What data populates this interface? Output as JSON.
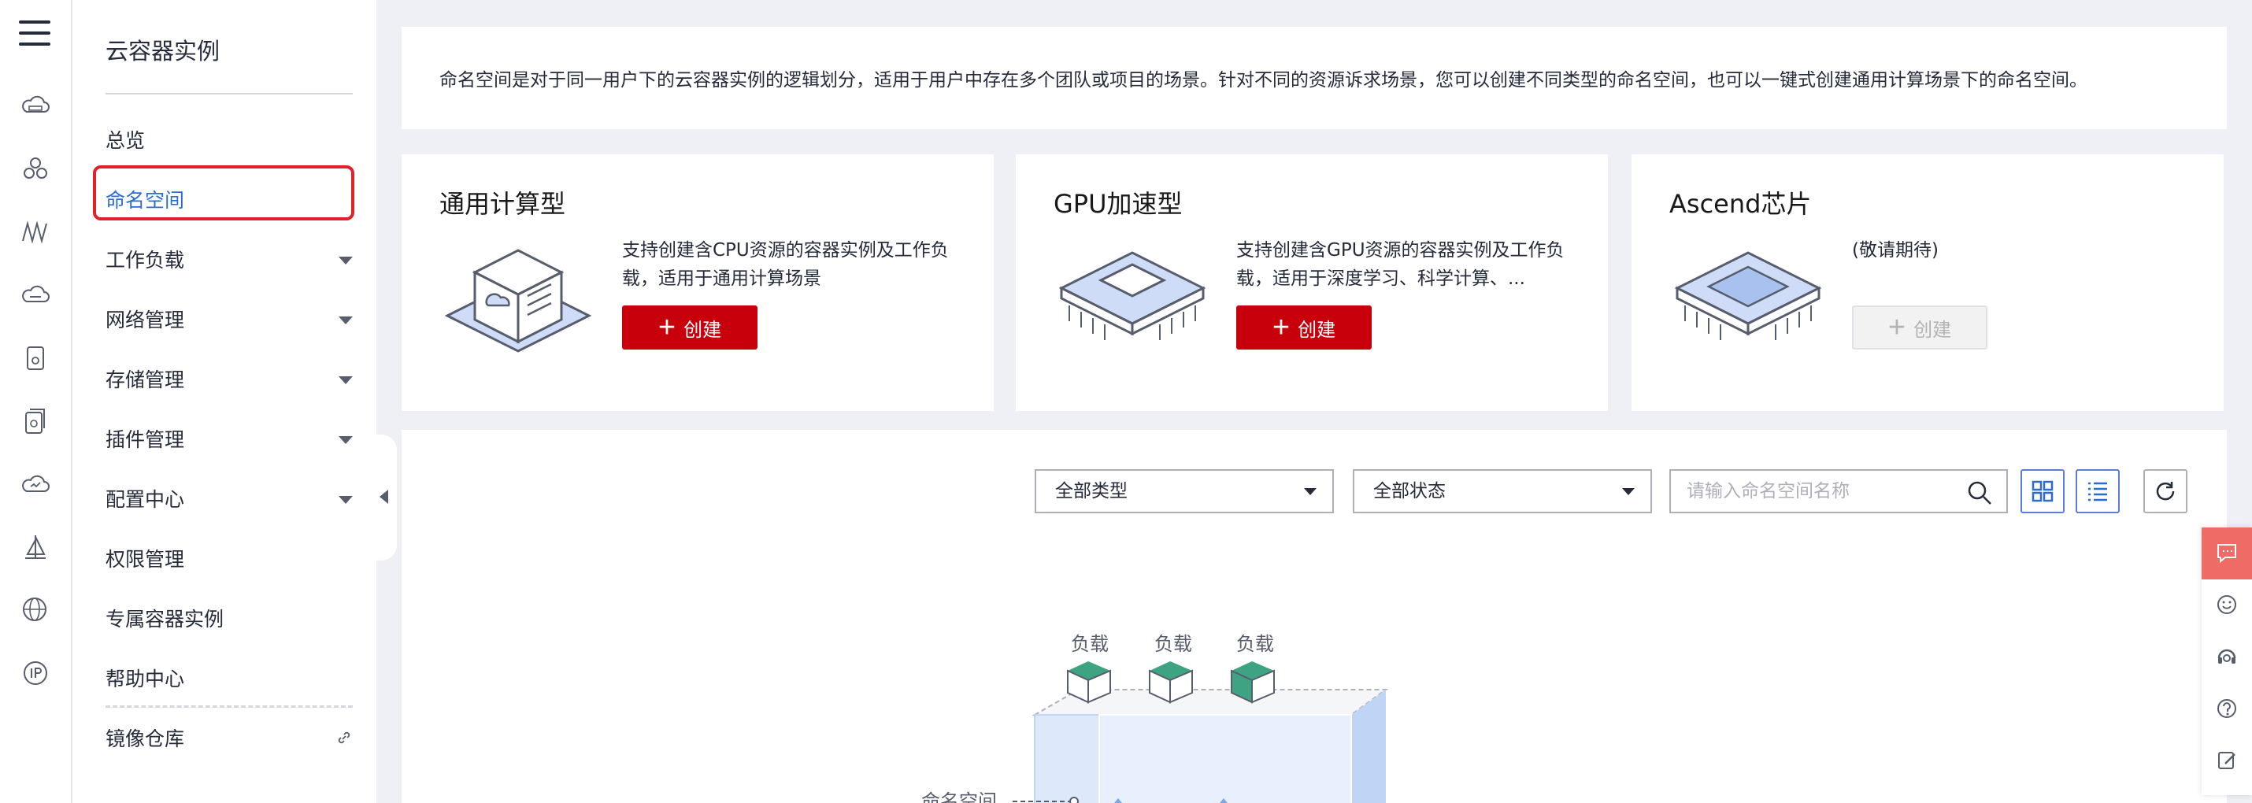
{
  "sidebar": {
    "title": "云容器实例",
    "items": [
      {
        "label": "总览"
      },
      {
        "label": "命名空间"
      },
      {
        "label": "工作负载"
      },
      {
        "label": "网络管理"
      },
      {
        "label": "存储管理"
      },
      {
        "label": "插件管理"
      },
      {
        "label": "配置中心"
      },
      {
        "label": "权限管理"
      },
      {
        "label": "专属容器实例"
      },
      {
        "label": "帮助中心"
      },
      {
        "label": "镜像仓库"
      }
    ]
  },
  "intro": {
    "text": "命名空间是对于同一用户下的云容器实例的逻辑划分，适用于用户中存在多个团队或项目的场景。针对不同的资源诉求场景，您可以创建不同类型的命名空间，也可以一键式创建通用计算场景下的命名空间。"
  },
  "cards": [
    {
      "title": "通用计算型",
      "desc": "支持创建含CPU资源的容器实例及工作负载，适用于通用计算场景",
      "button": "创建"
    },
    {
      "title": "GPU加速型",
      "desc": "支持创建含GPU资源的容器实例及工作负载，适用于深度学习、科学计算、...",
      "button": "创建"
    },
    {
      "title": "Ascend芯片",
      "desc": "(敬请期待)",
      "button": "创建"
    }
  ],
  "filters": {
    "type_select": "全部类型",
    "status_select": "全部状态",
    "search_placeholder": "请输入命名空间名称"
  },
  "illustration": {
    "workload_labels": [
      "负载",
      "负载",
      "负载"
    ],
    "namespace_label": "命名空间"
  },
  "colors": {
    "brand_red": "#c7000b",
    "active_blue": "#2a6cd6",
    "highlight_red": "#e0202a"
  }
}
